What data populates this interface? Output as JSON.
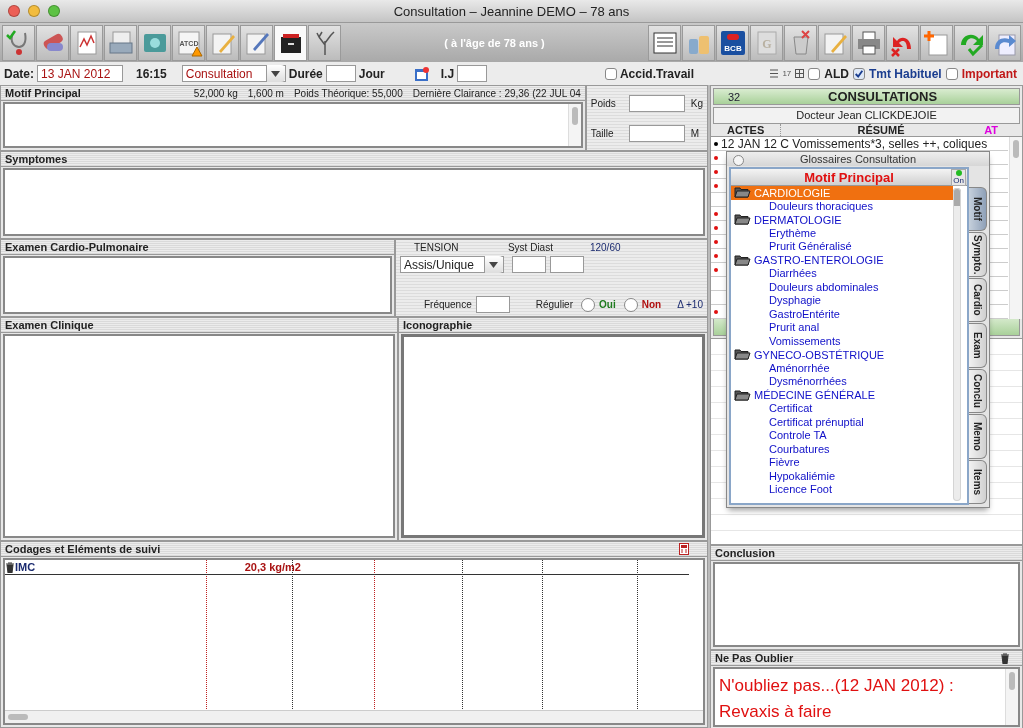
{
  "window": {
    "title": "Consultation – Jeannine DEMO – 78 ans"
  },
  "toolbar": {
    "age": "( à l'âge de 78 ans )",
    "atcd_icon_text": "ATCD",
    "logo_icon_text": "BCB",
    "book_icon_text": "G"
  },
  "header": {
    "date_label": "Date:",
    "date": "13 JAN 2012",
    "time": "16:15",
    "type": "Consultation",
    "duree_label": "Durée",
    "duree_unit": "Jour",
    "ij_label": "I.J",
    "accident": {
      "label": "Accid.Travail",
      "checked": false
    },
    "counter": "17",
    "ald": {
      "label": "ALD",
      "checked": false
    },
    "tmt": {
      "label": "Tmt Habituel",
      "checked": true
    },
    "important": {
      "label": "Important",
      "checked": false
    }
  },
  "motif": {
    "title": "Motif Principal",
    "poids": "52,000 kg",
    "taille": "1,600 m",
    "poids_theorique": "Poids Théorique: 55,000",
    "clairance": "Dernière Clairance : 29,36 (22 JUL 04"
  },
  "measures": {
    "poids_label": "Poids",
    "poids_unit": "Kg",
    "taille_label": "Taille",
    "taille_unit": "M"
  },
  "symptomes": {
    "title": "Symptomes"
  },
  "cardio": {
    "title": "Examen Cardio-Pulmonaire"
  },
  "tension": {
    "title": "TENSION",
    "syst_diast": "Syst Diast",
    "last": "120/60",
    "position": "Assis/Unique",
    "frequence": "Fréquence",
    "regulier": "Régulier",
    "options": [
      {
        "label": "Oui",
        "selected": false,
        "color": "#1e7a1e"
      },
      {
        "label": "Non",
        "selected": false,
        "color": "#b01010"
      }
    ],
    "delta": "Δ +10"
  },
  "clinique": {
    "title": "Examen Clinique"
  },
  "iconographie": {
    "title": "Iconographie"
  },
  "codages": {
    "title": "Codages et Eléments de suivi",
    "rows": [
      {
        "name": "IMC",
        "value": "20,3 kg/m2"
      }
    ]
  },
  "consultations": {
    "count": "32",
    "title": "CONSULTATIONS",
    "doctor": "Docteur Jean CLICKDEJOIE",
    "columns": [
      "ACTES",
      "RÉSUMÉ",
      "AT"
    ],
    "rows": [
      {
        "text": "12 JAN 12 C Vomissements*3, selles ++, coliques",
        "color": "#000000"
      },
      {
        "color": "#e01010"
      },
      {
        "color": "#e01010"
      },
      {
        "color": "#e01010"
      },
      {},
      {
        "color": "#e01010"
      },
      {
        "color": "#e01010"
      },
      {
        "color": "#e01010"
      },
      {
        "color": "#e01010"
      },
      {
        "color": "#e01010"
      },
      {},
      {},
      {
        "color": "#e01010"
      }
    ]
  },
  "conclusion": {
    "title": "Conclusion"
  },
  "memo": {
    "title": "Ne Pas Oublier",
    "text": "N'oubliez pas...(12 JAN 2012) : Revaxis à faire"
  },
  "glossary": {
    "title": "Glossaires Consultation",
    "header": "Motif Principal",
    "switch_label": "On",
    "switch_on": true,
    "tree": [
      {
        "label": "CARDIOLOGIE",
        "selected": true,
        "children": [
          {
            "label": "Douleurs thoraciques",
            "selected": false
          }
        ]
      },
      {
        "label": "DERMATOLOGIE",
        "selected": false,
        "children": [
          {
            "label": "Erythème",
            "selected": false
          },
          {
            "label": "Prurit Généralisé",
            "selected": false
          }
        ]
      },
      {
        "label": "GASTRO-ENTEROLOGIE",
        "selected": false,
        "children": [
          {
            "label": "Diarrhées",
            "selected": false
          },
          {
            "label": "Douleurs abdominales",
            "selected": false
          },
          {
            "label": "Dysphagie",
            "selected": false
          },
          {
            "label": "GastroEntérite",
            "selected": false
          },
          {
            "label": "Prurit anal",
            "selected": false
          },
          {
            "label": "Vomissements",
            "selected": false
          }
        ]
      },
      {
        "label": "GYNECO-OBSTÉTRIQUE",
        "selected": false,
        "children": [
          {
            "label": "Aménorrhée",
            "selected": false
          },
          {
            "label": "Dysménorrhées",
            "selected": false
          }
        ]
      },
      {
        "label": "MÉDECINE GÉNÉRALE",
        "selected": false,
        "children": [
          {
            "label": "Certificat",
            "selected": false
          },
          {
            "label": "Certificat prénuptial",
            "selected": false
          },
          {
            "label": "Controle TA",
            "selected": false
          },
          {
            "label": "Courbatures",
            "selected": false
          },
          {
            "label": "Fièvre",
            "selected": false
          },
          {
            "label": "Hypokaliémie",
            "selected": false
          },
          {
            "label": "Licence Foot",
            "selected": false
          }
        ]
      }
    ],
    "tabs": [
      {
        "label": "Motif",
        "selected": true
      },
      {
        "label": "Sympto.",
        "selected": false
      },
      {
        "label": "Cardio",
        "selected": false
      },
      {
        "label": "Exam",
        "selected": false
      },
      {
        "label": "Conclu",
        "selected": false
      },
      {
        "label": "Memo",
        "selected": false
      },
      {
        "label": "Items",
        "selected": false
      }
    ]
  }
}
